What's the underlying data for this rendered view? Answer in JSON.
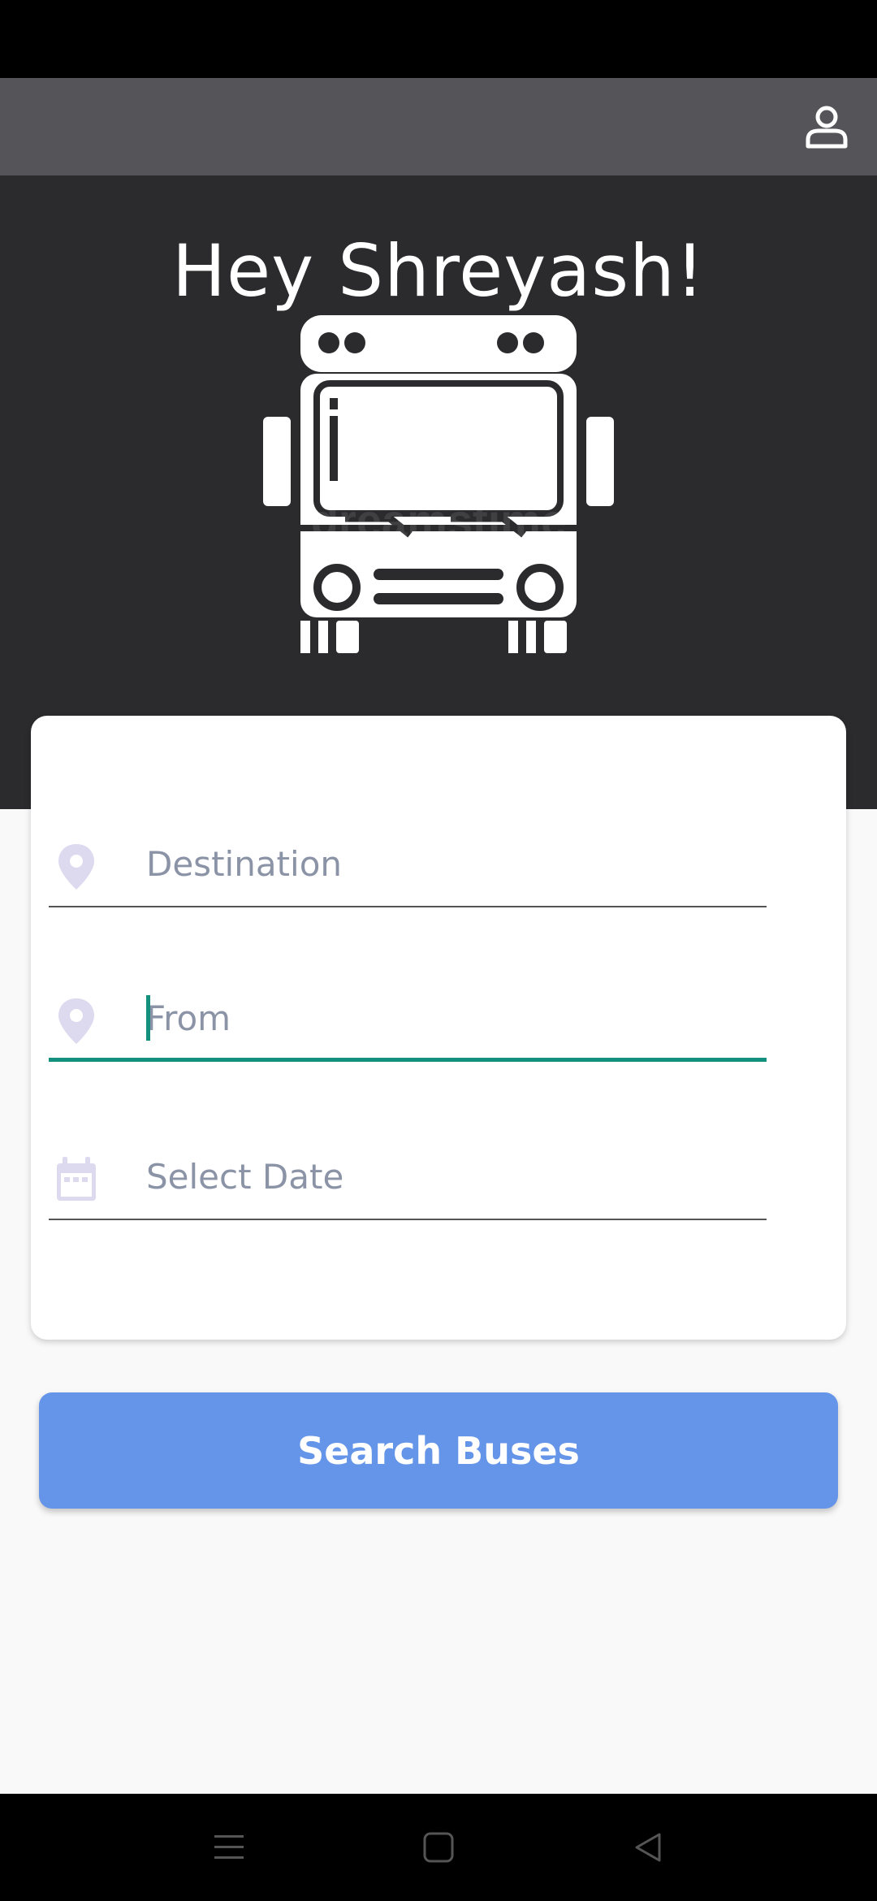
{
  "header": {
    "profile_icon": "person-icon"
  },
  "hero": {
    "greeting": "Hey Shreyash!",
    "illustration": "bus-front-icon",
    "watermark": "dreamstime"
  },
  "form": {
    "destination": {
      "icon": "location-pin-icon",
      "placeholder": "Destination",
      "value": ""
    },
    "from": {
      "icon": "location-pin-icon",
      "placeholder": "From",
      "value": "",
      "focused": true
    },
    "date": {
      "icon": "calendar-icon",
      "placeholder": "Select Date",
      "value": ""
    }
  },
  "actions": {
    "search_label": "Search Buses"
  },
  "system_nav": {
    "menu_icon": "menu-icon",
    "home_icon": "home-square-icon",
    "back_icon": "back-triangle-icon"
  },
  "colors": {
    "app_bar": "#545459",
    "hero_bg": "#2b2a2c",
    "accent_focus": "#13917e",
    "button_bg": "#6595e8",
    "icon_tint": "#ddd9ef",
    "placeholder_text": "#8b93a6"
  }
}
